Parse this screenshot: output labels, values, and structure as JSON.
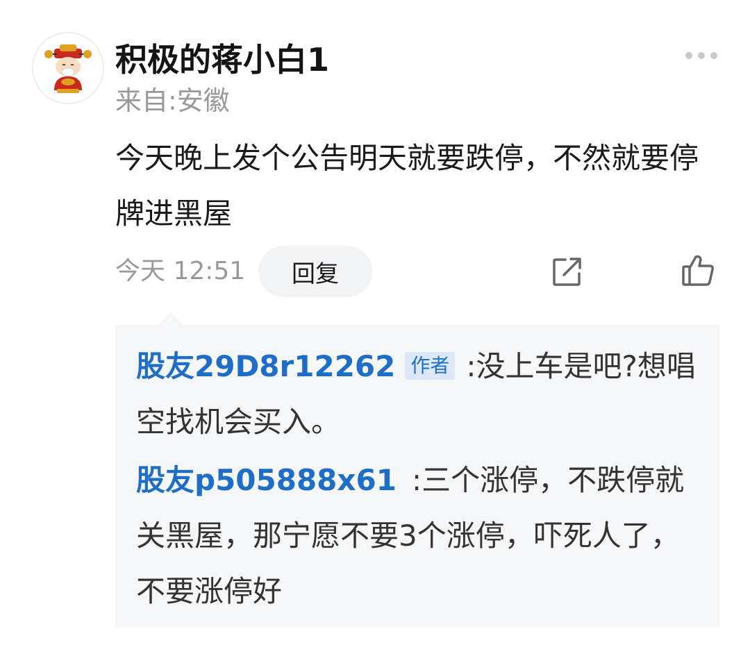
{
  "comment": {
    "username": "积极的蒋小白1",
    "location": "来自:安徽",
    "text": "今天晚上发个公告明天就要跌停，不然就要停牌进黑屋",
    "timestamp": "今天 12:51",
    "reply_label": "回复",
    "icons": {
      "more": "more-dots-icon",
      "share": "share-icon",
      "like": "thumbs-up-icon",
      "avatar": "fortune-god-avatar"
    }
  },
  "replies": [
    {
      "author": "股友29D8r12262",
      "badge": "作者",
      "separator": ":",
      "text": "没上车是吧?想唱空找机会买入。"
    },
    {
      "author": "股友p505888x61",
      "separator": ":",
      "text": "三个涨停，不跌停就关黑屋，那宁愿不要3个涨停，吓死人了，不要涨停好"
    }
  ],
  "colors": {
    "link_blue": "#1e6dc7",
    "muted_gray": "#999999",
    "reply_bg": "#f5f6f8",
    "badge_bg": "#dce8f8"
  }
}
